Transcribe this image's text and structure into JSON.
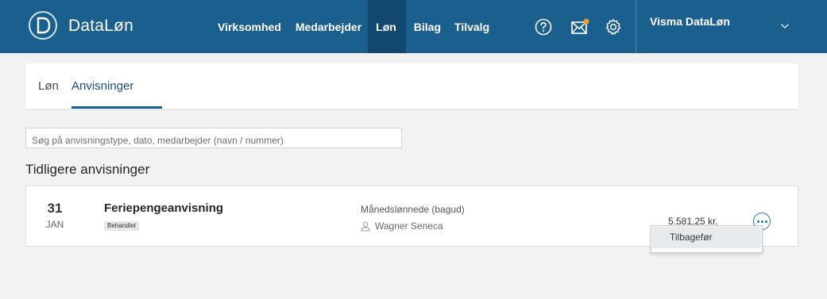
{
  "header": {
    "app_title": "DataLøn",
    "logo_icon": "dataløn-logo-icon",
    "nav": [
      {
        "label": "Virksomhed",
        "active": false
      },
      {
        "label": "Medarbejder",
        "active": false
      },
      {
        "label": "Løn",
        "active": true
      },
      {
        "label": "Bilag",
        "active": false
      },
      {
        "label": "Tilvalg",
        "active": false
      }
    ],
    "icons": [
      "help-icon",
      "mail-icon",
      "settings-icon"
    ],
    "company": "Visma DataLøn",
    "accent_color": "#1b5f8f",
    "active_color": "#124770",
    "notification_color": "#f29a22"
  },
  "tabs": [
    {
      "label": "Løn",
      "active": false
    },
    {
      "label": "Anvisninger",
      "active": true
    }
  ],
  "search": {
    "placeholder": "Søg på anvisningstype, dato, medarbejder (navn / nummer)"
  },
  "section_title": "Tidligere anvisninger",
  "items": [
    {
      "day": "31",
      "month": "JAN",
      "title": "Feriepengeanvisning",
      "status": "Behandlet",
      "type": "Månedslønnede (bagud)",
      "employee": "Wagner Seneca",
      "amount": "5.581,25 kr."
    }
  ],
  "dropdown": {
    "items": [
      "Tilbagefør"
    ]
  }
}
